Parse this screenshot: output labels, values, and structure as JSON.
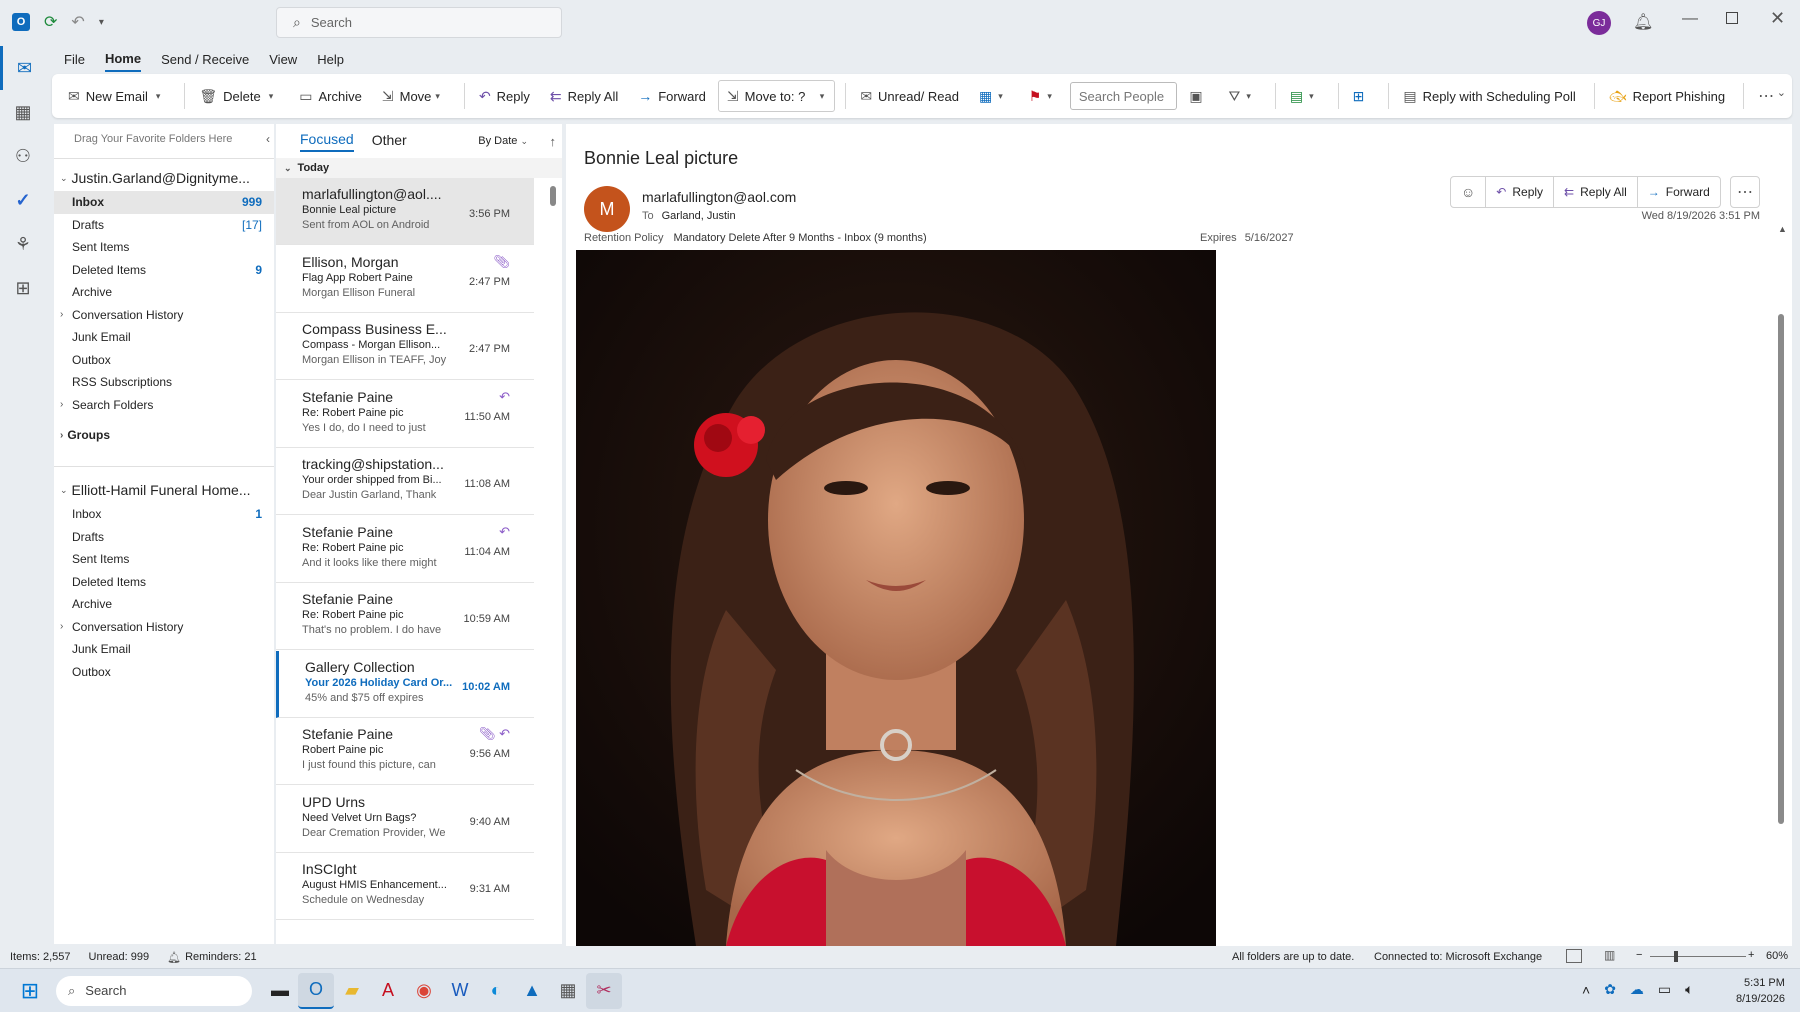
{
  "titlebar": {
    "search_placeholder": "Search",
    "avatar_initials": "GJ"
  },
  "menu": {
    "file": "File",
    "home": "Home",
    "send_receive": "Send / Receive",
    "view": "View",
    "help": "Help"
  },
  "ribbon": {
    "new_email": "New Email",
    "delete": "Delete",
    "archive": "Archive",
    "move": "Move",
    "reply": "Reply",
    "reply_all": "Reply All",
    "forward": "Forward",
    "move_to": "Move to: ?",
    "unread_read": "Unread/ Read",
    "search_people": "Search People",
    "reply_poll": "Reply with Scheduling Poll",
    "report_phishing": "Report Phishing"
  },
  "folders": {
    "drag_hint": "Drag Your Favorite Folders Here",
    "account1": "Justin.Garland@Dignityme...",
    "account1_items": [
      {
        "label": "Inbox",
        "count": "999",
        "selected": true
      },
      {
        "label": "Drafts",
        "count": "[17]"
      },
      {
        "label": "Sent Items",
        "count": ""
      },
      {
        "label": "Deleted Items",
        "count": "9"
      },
      {
        "label": "Archive",
        "count": ""
      },
      {
        "label": "Conversation History",
        "count": "",
        "expand": true
      },
      {
        "label": "Junk Email",
        "count": ""
      },
      {
        "label": "Outbox",
        "count": ""
      },
      {
        "label": "RSS Subscriptions",
        "count": ""
      },
      {
        "label": "Search Folders",
        "count": "",
        "expand": true
      }
    ],
    "groups": "Groups",
    "account2": "Elliott-Hamil Funeral Home...",
    "account2_items": [
      {
        "label": "Inbox",
        "count": "1"
      },
      {
        "label": "Drafts",
        "count": ""
      },
      {
        "label": "Sent Items",
        "count": ""
      },
      {
        "label": "Deleted Items",
        "count": ""
      },
      {
        "label": "Archive",
        "count": ""
      },
      {
        "label": "Conversation History",
        "count": "",
        "expand": true
      },
      {
        "label": "Junk Email",
        "count": ""
      },
      {
        "label": "Outbox",
        "count": ""
      }
    ]
  },
  "list": {
    "tab_focused": "Focused",
    "tab_other": "Other",
    "sort": "By Date",
    "group_today": "Today",
    "messages": [
      {
        "sender": "marlafullington@aol....",
        "subject": "Bonnie Leal picture",
        "preview": "Sent from AOL on Android",
        "time": "3:56 PM",
        "selected": true
      },
      {
        "sender": "Ellison, Morgan",
        "subject": "Flag App Robert Paine",
        "preview": "Morgan Ellison Funeral",
        "time": "2:47 PM",
        "icon": "attachment-icon"
      },
      {
        "sender": "Compass Business E...",
        "subject": "Compass - Morgan Ellison...",
        "preview": "Morgan Ellison in TEAFF, Joy",
        "time": "2:47 PM"
      },
      {
        "sender": "Stefanie Paine",
        "subject": "Re: Robert Paine pic",
        "preview": "Yes I do, do I need to just",
        "time": "11:50 AM",
        "icon": "replied-icon"
      },
      {
        "sender": "tracking@shipstation...",
        "subject": "Your order shipped from Bi...",
        "preview": "Dear Justin Garland, Thank",
        "time": "11:08 AM"
      },
      {
        "sender": "Stefanie Paine",
        "subject": "Re: Robert Paine pic",
        "preview": "And it looks like there might",
        "time": "11:04 AM",
        "icon": "replied-icon"
      },
      {
        "sender": "Stefanie Paine",
        "subject": "Re: Robert Paine pic",
        "preview": "That's no problem. I do have",
        "time": "10:59 AM"
      },
      {
        "sender": "Gallery Collection",
        "subject": "Your 2026 Holiday Card Or...",
        "preview": "45% and $75 off expires",
        "time": "10:02 AM",
        "unread": true
      },
      {
        "sender": "Stefanie Paine",
        "subject": "Robert Paine pic",
        "preview": "I just found this picture, can",
        "time": "9:56 AM",
        "icon": "attachment-replied-icon"
      },
      {
        "sender": "UPD Urns",
        "subject": "Need Velvet Urn Bags?",
        "preview": "Dear Cremation Provider, We",
        "time": "9:40 AM"
      },
      {
        "sender": "InSCIght",
        "subject": "August HMIS Enhancement...",
        "preview": "Schedule on Wednesday",
        "time": "9:31 AM"
      }
    ]
  },
  "reading": {
    "subject": "Bonnie Leal picture",
    "avatar": "M",
    "from": "marlafullington@aol.com",
    "to_label": "To",
    "to": "Garland, Justin",
    "retention_label": "Retention Policy",
    "retention": "Mandatory Delete After 9 Months - Inbox (9 months)",
    "expires_label": "Expires",
    "expires": "5/16/2027",
    "reply": "Reply",
    "reply_all": "Reply All",
    "forward": "Forward",
    "date": "Wed 8/19/2026 3:51 PM"
  },
  "status": {
    "items": "Items: 2,557",
    "unread": "Unread: 999",
    "reminders": "Reminders: 21",
    "sync": "All folders are up to date.",
    "connection": "Connected to: Microsoft Exchange",
    "zoom": "60%"
  },
  "taskbar": {
    "search": "Search",
    "time": "5:31 PM",
    "date": "8/19/2026"
  },
  "colors": {
    "accent": "#0f6cbd",
    "avatar_bg": "#c4531c",
    "gj_avatar": "#7b2c9a",
    "flag": "#c50f1f"
  }
}
